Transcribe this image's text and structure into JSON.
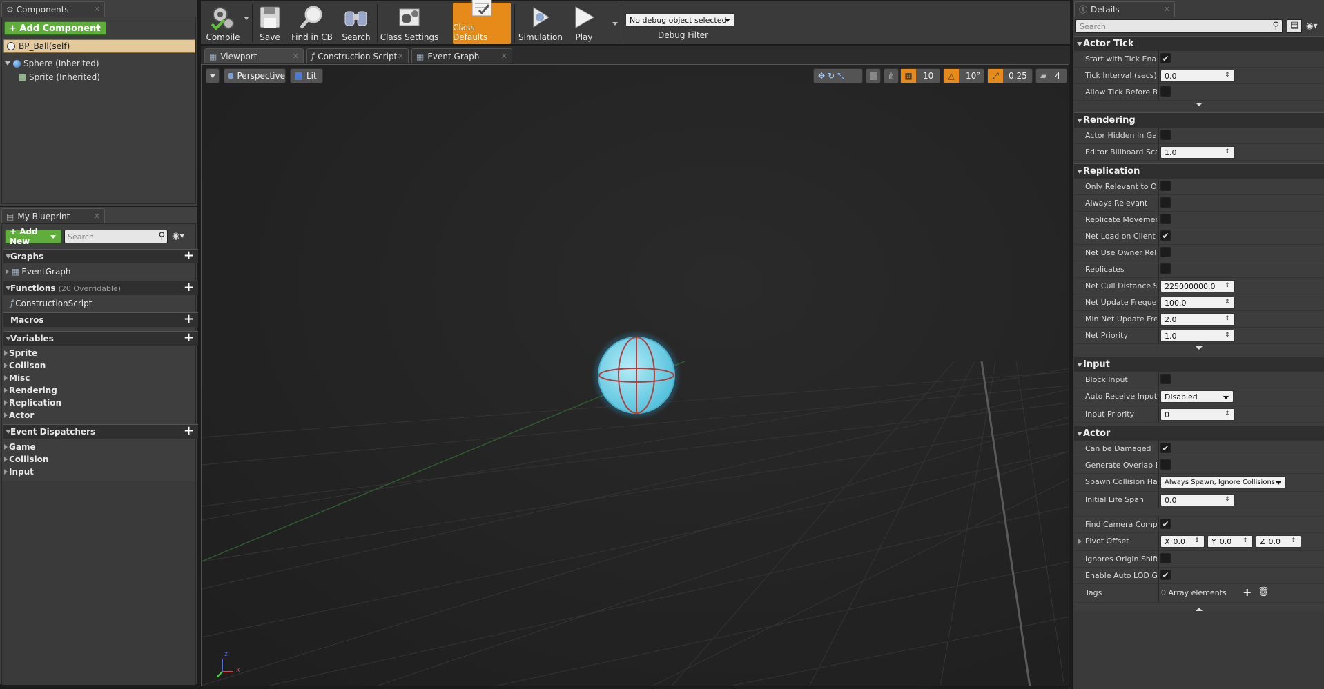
{
  "components": {
    "tab_label": "Components",
    "add_label": "+ Add Component",
    "self_label": "BP_Ball(self)",
    "tree": [
      "Sphere (Inherited)",
      "Sprite (Inherited)"
    ]
  },
  "my_blueprint": {
    "tab_label": "My Blueprint",
    "add_label": "+ Add New",
    "search_placeholder": "Search",
    "graphs": {
      "label": "Graphs",
      "items": [
        "EventGraph"
      ]
    },
    "functions": {
      "label": "Functions",
      "count": "(20 Overridable)",
      "items": [
        "ConstructionScript"
      ]
    },
    "macros": {
      "label": "Macros"
    },
    "variables": {
      "label": "Variables",
      "items": [
        "Sprite",
        "Collison",
        "Misc",
        "Rendering",
        "Replication",
        "Actor"
      ]
    },
    "dispatchers": {
      "label": "Event Dispatchers",
      "items": [
        "Game",
        "Collision",
        "Input"
      ]
    }
  },
  "toolbar": {
    "compile": "Compile",
    "save": "Save",
    "find_in_cb": "Find in CB",
    "search": "Search",
    "class_settings": "Class Settings",
    "class_defaults": "Class Defaults",
    "simulation": "Simulation",
    "play": "Play",
    "debug_select": "No debug object selected",
    "debug_filter": "Debug Filter"
  },
  "editor_tabs": {
    "viewport": "Viewport",
    "construction": "Construction Script",
    "event_graph": "Event Graph"
  },
  "viewport": {
    "perspective": "Perspective",
    "lit": "Lit",
    "grid_snap": "10",
    "rot_snap": "10°",
    "scale_snap": "0.25",
    "cam_speed": "4",
    "axis_x": "x",
    "axis_z": "z"
  },
  "details": {
    "tab_label": "Details",
    "search_placeholder": "Search",
    "actor_tick": {
      "label": "Actor Tick",
      "start_with_tick": {
        "label": "Start with Tick Enabled",
        "checked": true
      },
      "tick_interval": {
        "label": "Tick Interval (secs)",
        "value": "0.0"
      },
      "allow_tick": {
        "label": "Allow Tick Before BeginPlay",
        "checked": false
      }
    },
    "rendering": {
      "label": "Rendering",
      "hidden": {
        "label": "Actor Hidden In Game",
        "checked": false
      },
      "billboard": {
        "label": "Editor Billboard Scale",
        "value": "1.0"
      }
    },
    "replication": {
      "label": "Replication",
      "only_relevant": {
        "label": "Only Relevant to Owner",
        "checked": false
      },
      "always_relevant": {
        "label": "Always Relevant",
        "checked": false
      },
      "replicate_movement": {
        "label": "Replicate Movement",
        "checked": false
      },
      "net_load": {
        "label": "Net Load on Client",
        "checked": true
      },
      "net_use_owner": {
        "label": "Net Use Owner Relevancy",
        "checked": false
      },
      "replicates": {
        "label": "Replicates",
        "checked": false
      },
      "net_cull": {
        "label": "Net Cull Distance Squared",
        "value": "225000000.0"
      },
      "net_update": {
        "label": "Net Update Frequency",
        "value": "100.0"
      },
      "min_net_update": {
        "label": "Min Net Update Frequency",
        "value": "2.0"
      },
      "net_priority": {
        "label": "Net Priority",
        "value": "1.0"
      }
    },
    "input": {
      "label": "Input",
      "block_input": {
        "label": "Block Input",
        "checked": false
      },
      "auto_receive": {
        "label": "Auto Receive Input",
        "value": "Disabled"
      },
      "input_priority": {
        "label": "Input Priority",
        "value": "0"
      }
    },
    "actor": {
      "label": "Actor",
      "can_be_damaged": {
        "label": "Can be Damaged",
        "checked": true
      },
      "gen_overlap": {
        "label": "Generate Overlap Events During Level Streaming",
        "checked": false
      },
      "spawn_collision": {
        "label": "Spawn Collision Handling Method",
        "value": "Always Spawn, Ignore Collisions"
      },
      "life_span": {
        "label": "Initial Life Span",
        "value": "0.0"
      },
      "find_camera": {
        "label": "Find Camera Component When View Target",
        "checked": true
      },
      "pivot": {
        "label": "Pivot Offset",
        "x": "0.0",
        "y": "0.0",
        "z": "0.0",
        "x_label": "X",
        "y_label": "Y",
        "z_label": "Z"
      },
      "ignores_origin": {
        "label": "Ignores Origin Shifting",
        "checked": false
      },
      "auto_lod": {
        "label": "Enable Auto LOD Generation",
        "checked": true
      },
      "tags": {
        "label": "Tags",
        "value": "0 Array elements"
      }
    }
  }
}
